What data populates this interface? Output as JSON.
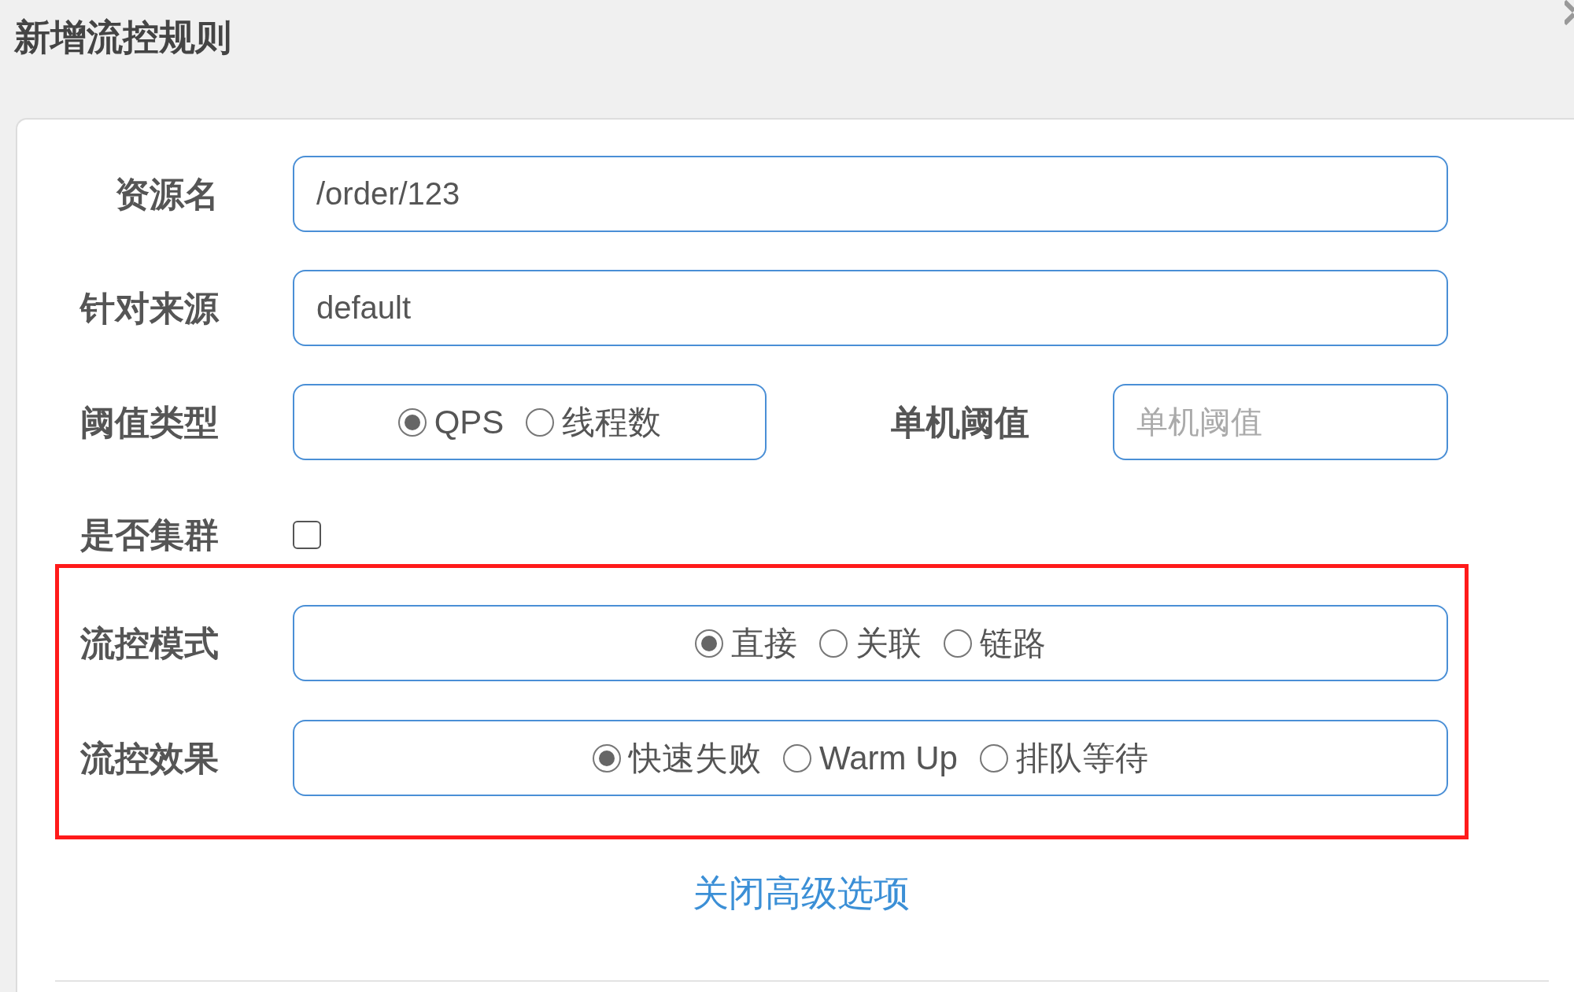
{
  "dialog": {
    "title": "新增流控规则"
  },
  "resource": {
    "label": "资源名",
    "value": "/order/123"
  },
  "origin": {
    "label": "针对来源",
    "value": "default"
  },
  "threshold_type": {
    "label": "阈值类型",
    "options": [
      {
        "label": "QPS",
        "selected": true
      },
      {
        "label": "线程数",
        "selected": false
      }
    ]
  },
  "single_threshold": {
    "label": "单机阈值",
    "placeholder": "单机阈值"
  },
  "cluster": {
    "label": "是否集群",
    "checked": false
  },
  "flow_mode": {
    "label": "流控模式",
    "options": [
      {
        "label": "直接",
        "selected": true
      },
      {
        "label": "关联",
        "selected": false
      },
      {
        "label": "链路",
        "selected": false
      }
    ]
  },
  "flow_effect": {
    "label": "流控效果",
    "options": [
      {
        "label": "快速失败",
        "selected": true
      },
      {
        "label": "Warm Up",
        "selected": false
      },
      {
        "label": "排队等待",
        "selected": false
      }
    ]
  },
  "advanced_link": "关闭高级选项"
}
